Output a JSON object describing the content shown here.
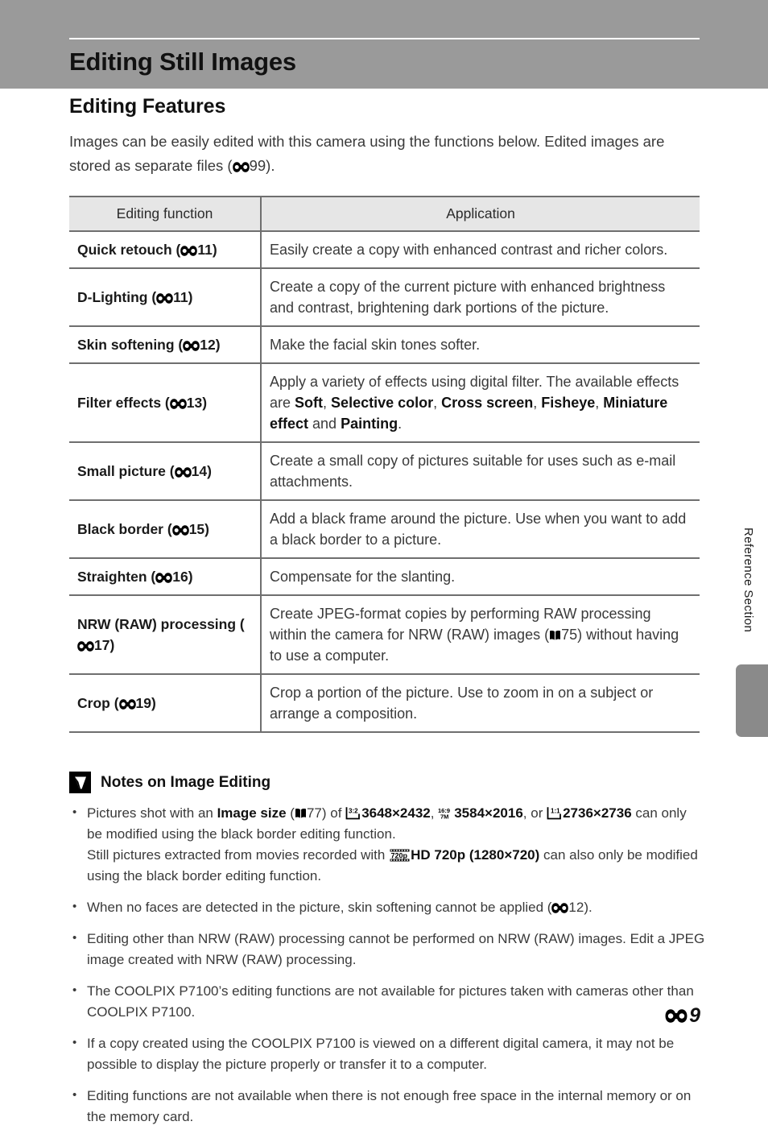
{
  "header": {
    "title": "Editing Still Images"
  },
  "section": {
    "title": "Editing Features",
    "intro_part1": "Images can be easily edited with this camera using the functions below. Edited images are stored as separate files (",
    "intro_ref": "99",
    "intro_part2": ")."
  },
  "table": {
    "headers": [
      "Editing function",
      "Application"
    ],
    "rows": [
      {
        "function_name": "Quick retouch (",
        "function_ref": "11",
        "function_tail": ")",
        "application": "Easily create a copy with enhanced contrast and richer colors."
      },
      {
        "function_name": "D-Lighting (",
        "function_ref": "11",
        "function_tail": ")",
        "application": "Create a copy of the current picture with enhanced brightness and contrast, brightening dark portions of the picture."
      },
      {
        "function_name": "Skin softening (",
        "function_ref": "12",
        "function_tail": ")",
        "application": "Make the facial skin tones softer."
      },
      {
        "function_name": "Filter effects (",
        "function_ref": "13",
        "function_tail": ")",
        "application_part1": "Apply a variety of effects using digital filter. The available effects are ",
        "effects": [
          "Soft",
          "Selective color",
          "Cross screen",
          "Fisheye",
          "Miniature effect",
          "Painting"
        ],
        "application_conjunction": " and ",
        "application_tail": "."
      },
      {
        "function_name": "Small picture (",
        "function_ref": "14",
        "function_tail": ")",
        "application": "Create a small copy of pictures suitable for uses such as e-mail attachments."
      },
      {
        "function_name": "Black border (",
        "function_ref": "15",
        "function_tail": ")",
        "application": "Add a black frame around the picture. Use when you want to add a black border to a picture."
      },
      {
        "function_name": "Straighten (",
        "function_ref": "16",
        "function_tail": ")",
        "application": "Compensate for the slanting."
      },
      {
        "function_name": "NRW (RAW) processing (",
        "function_ref": "17",
        "function_tail": ")",
        "application_part1": "Create JPEG-format copies by performing RAW processing within the camera for NRW (RAW) images (",
        "application_book_ref": "75",
        "application_part2": ") without having to use a computer."
      },
      {
        "function_name": "Crop (",
        "function_ref": "19",
        "function_tail": ")",
        "application": "Crop a portion of the picture. Use to zoom in on a subject or arrange a composition."
      }
    ]
  },
  "notes": {
    "title": "Notes on Image Editing",
    "items": [
      {
        "seg1": "Pictures shot with an ",
        "bold1": "Image size",
        "seg2": " (",
        "book_ref": "77",
        "seg3": ") of ",
        "ratio1_label": "3:2",
        "ratio1_sub": "",
        "bold2": "3648×2432",
        "seg4": ", ",
        "ratio2_label": "16:9",
        "ratio2_sub": "7M",
        "bold3": "3584×2016",
        "seg5": ", or ",
        "ratio3_label": "1:1",
        "ratio3_sub": "",
        "bold4": "2736×2736",
        "seg6": " can only be modified using the black border editing function.",
        "line2_seg1": "Still pictures extracted from movies recorded with ",
        "film_label": "720p",
        "line2_bold": "HD 720p (1280×720)",
        "line2_seg2": " can also only be modified using the black border editing function."
      },
      {
        "seg1": "When no faces are detected in the picture, skin softening cannot be applied (",
        "e_ref": "12",
        "seg2": ")."
      },
      {
        "text": "Editing other than NRW (RAW) processing cannot be performed on NRW (RAW) images. Edit a JPEG image created with NRW (RAW) processing."
      },
      {
        "text": "The COOLPIX P7100’s editing functions are not available for pictures taken with cameras other than COOLPIX P7100."
      },
      {
        "text": "If a copy created using the COOLPIX P7100 is viewed on a different digital camera, it may not be possible to display the picture properly or transfer it to a computer."
      },
      {
        "text": "Editing functions are not available when there is not enough free space in the internal memory or on the memory card."
      }
    ]
  },
  "sidebar": {
    "label": "Reference Section"
  },
  "footer": {
    "page_number": "9"
  },
  "colors": {
    "header_band": "#9a9a9a",
    "table_border": "#6f6f6f",
    "table_header_bg": "#e6e6e6",
    "side_tab": "#8a8a8a",
    "body_text": "#3a3a3a"
  }
}
